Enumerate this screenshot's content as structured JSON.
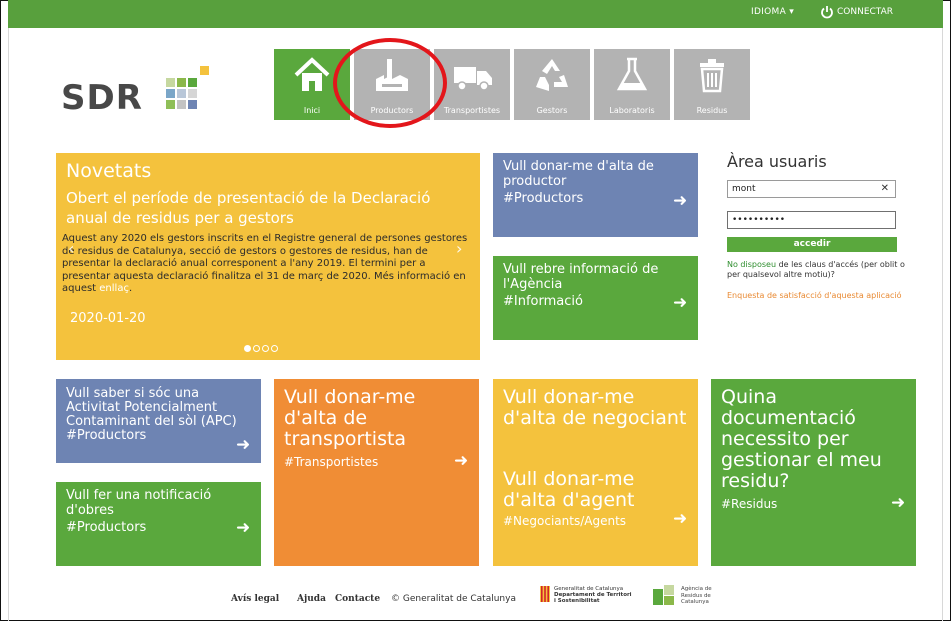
{
  "topbar": {
    "language": "IDIOMA ▾",
    "connect": "CONNECTAR"
  },
  "logo": {
    "text": "SDR"
  },
  "nav": [
    {
      "label": "Inici",
      "icon": "home-icon",
      "active": true
    },
    {
      "label": "Productors",
      "icon": "factory-icon"
    },
    {
      "label": "Transportistes",
      "icon": "truck-icon"
    },
    {
      "label": "Gestors",
      "icon": "recycle-icon"
    },
    {
      "label": "Laboratoris",
      "icon": "flask-icon"
    },
    {
      "label": "Residus",
      "icon": "trash-icon"
    }
  ],
  "news": {
    "title": "Novetats",
    "headline": "Obert el període de presentació de la Declaració anual de residus per a gestors",
    "body": "Aquest any 2020 els gestors inscrits en el Registre general de persones gestores de residus de Catalunya, secció de gestors o gestores de residus, han de presentar la declaració anual corresponent a l'any 2019. El termini per a presentar aquesta declaració finalitza el 31 de març de 2020. Més informació en aquest ",
    "link": "enllaç",
    "body_end": ".",
    "date": "2020-01-20"
  },
  "tiles": {
    "alta_productor": {
      "text": "Vull donar-me d'alta de productor",
      "tag": "#Productors"
    },
    "informacio": {
      "text": "Vull rebre informació de l'Agència",
      "tag": "#Informació"
    },
    "apc": {
      "text": "Vull saber si sóc una Activitat Potencialment Contaminant del sòl (APC)",
      "tag": "#Productors"
    },
    "obres": {
      "text": "Vull fer una notificació d'obres",
      "tag": "#Productors"
    },
    "transportista": {
      "text": "Vull donar-me d'alta de transportista",
      "tag": "#Transportistes"
    },
    "negociant": {
      "text": "Vull donar-me d'alta de negociant",
      "text2": "Vull donar-me d'alta d'agent",
      "tag": "#Negociants/Agents"
    },
    "documentacio": {
      "text": "Quina documentació necessito per gestionar el meu residu?",
      "tag": "#Residus"
    }
  },
  "login": {
    "title": "Àrea usuaris",
    "username": "mont",
    "password": "••••••••••",
    "submit": "accedir",
    "no_keys_link": "No disposeu",
    "no_keys_text": " de les claus d'accés (per oblit o per qualsevol altre motiu)?",
    "survey": "Enquesta de satisfacció d'aquesta aplicació"
  },
  "footer": {
    "legal": "Avís legal",
    "help": "Ajuda",
    "contact": "Contacte",
    "copyright": "© Generalitat de Catalunya",
    "gen_line1": "Generalitat de Catalunya",
    "gen_line2": "Departament de Territori",
    "gen_line3": "i Sostenibilitat",
    "agency_line1": "Agència de",
    "agency_line2": "Residus de",
    "agency_line3": "Catalunya"
  },
  "colors": {
    "green": "#5aa83d",
    "yellow": "#f4c23d",
    "blue": "#6e84b3",
    "orange": "#f08d35",
    "gray_tile": "#b3b3b3",
    "highlight": "#e3161b"
  }
}
